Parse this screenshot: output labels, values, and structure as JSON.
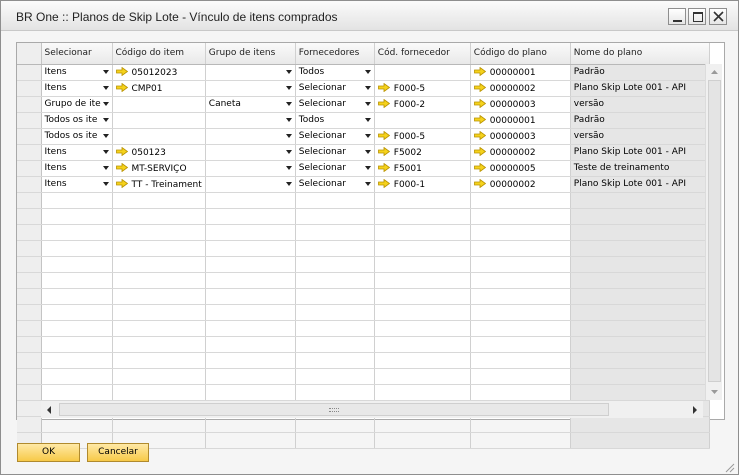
{
  "window": {
    "title": "BR One :: Planos de Skip Lote - Vínculo de itens comprados"
  },
  "grid": {
    "columns": [
      "Selecionar",
      "Código do item",
      "Grupo de itens",
      "Fornecedores",
      "Cód. fornecedor",
      "Código do plano",
      "Nome do plano"
    ],
    "rows": [
      {
        "selecionar": "Itens",
        "codigo_item": "05012023",
        "grupo": "",
        "fornecedores": "Todos",
        "cod_fornecedor": "",
        "codigo_plano": "00000001",
        "nome_plano": "Padrão"
      },
      {
        "selecionar": "Itens",
        "codigo_item": "CMP01",
        "grupo": "",
        "fornecedores": "Selecionar",
        "cod_fornecedor": "F000-5",
        "codigo_plano": "00000002",
        "nome_plano": "Plano Skip Lote 001 - API"
      },
      {
        "selecionar": "Grupo de ite",
        "codigo_item": "",
        "grupo": "Caneta",
        "fornecedores": "Selecionar",
        "cod_fornecedor": "F000-2",
        "codigo_plano": "00000003",
        "nome_plano": "versão"
      },
      {
        "selecionar": "Todos os ite",
        "codigo_item": "",
        "grupo": "",
        "fornecedores": "Todos",
        "cod_fornecedor": "",
        "codigo_plano": "00000001",
        "nome_plano": "Padrão"
      },
      {
        "selecionar": "Todos os ite",
        "codigo_item": "",
        "grupo": "",
        "fornecedores": "Selecionar",
        "cod_fornecedor": "F000-5",
        "codigo_plano": "00000003",
        "nome_plano": "versão"
      },
      {
        "selecionar": "Itens",
        "codigo_item": "050123",
        "grupo": "",
        "fornecedores": "Selecionar",
        "cod_fornecedor": "F5002",
        "codigo_plano": "00000002",
        "nome_plano": "Plano Skip Lote 001 - API"
      },
      {
        "selecionar": "Itens",
        "codigo_item": "MT-SERVIÇO",
        "grupo": "",
        "fornecedores": "Selecionar",
        "cod_fornecedor": "F5001",
        "codigo_plano": "00000005",
        "nome_plano": "Teste de treinamento"
      },
      {
        "selecionar": "Itens",
        "codigo_item": "TT - Treinament",
        "grupo": "",
        "fornecedores": "Selecionar",
        "cod_fornecedor": "F000-1",
        "codigo_plano": "00000002",
        "nome_plano": "Plano Skip Lote 001 - API"
      }
    ],
    "empty_rows": 16
  },
  "buttons": {
    "ok": "OK",
    "cancel": "Cancelar"
  },
  "colors": {
    "button_fill": "#f7c948",
    "link_arrow": "#f5d21c",
    "readonly_cell": "#e6e6e6"
  },
  "icons": {
    "link_arrow": "yellow-link-arrow-icon",
    "dropdown": "dropdown-arrow-icon"
  }
}
